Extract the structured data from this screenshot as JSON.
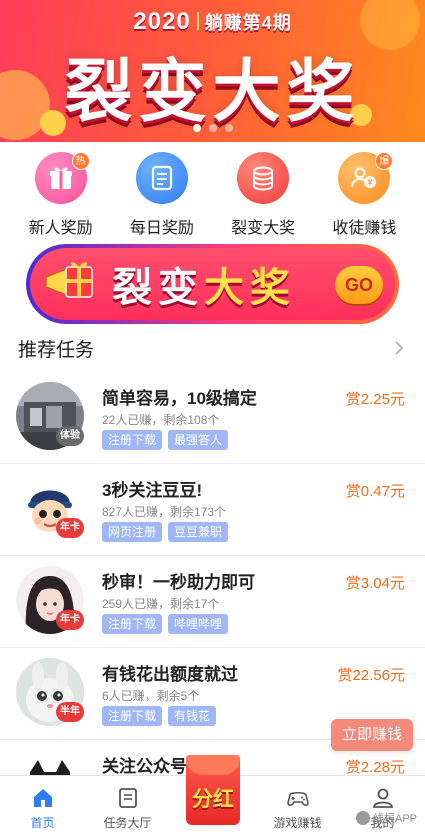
{
  "banner": {
    "year": "2020",
    "subtitle": "躺赚第4期",
    "title": "裂变大奖",
    "slides": 3,
    "active_slide": 1
  },
  "categories": [
    {
      "label": "新人奖励",
      "icon": "gift-icon",
      "badge": "热",
      "color": "#ff5fa2"
    },
    {
      "label": "每日奖励",
      "icon": "checklist-icon",
      "badge": "",
      "color": "#3a8ef6"
    },
    {
      "label": "裂变大奖",
      "icon": "coin-stack-icon",
      "badge": "",
      "color": "#ff4a4a"
    },
    {
      "label": "收徒赚钱",
      "icon": "users-icon",
      "badge": "爆",
      "color": "#ff9a2e"
    }
  ],
  "promo": {
    "text_part1": "裂变",
    "text_part2": "大奖",
    "go_label": "GO"
  },
  "section": {
    "title": "推荐任务"
  },
  "tasks": [
    {
      "title": "简单容易，10级搞定",
      "meta": "22人已赚，剩余108个",
      "tags": [
        "注册下载",
        "最强答人"
      ],
      "reward": "赏2.25元",
      "avatar_tag": "体验",
      "avatar_style": "photo-gray"
    },
    {
      "title": "3秒关注豆豆!",
      "meta": "827人已赚，剩余173个",
      "tags": [
        "网页注册",
        "豆豆兼职"
      ],
      "reward": "赏0.47元",
      "avatar_tag": "年卡",
      "avatar_style": "cartoon"
    },
    {
      "title": "秒审！一秒助力即可",
      "meta": "259人已赚，剩余17个",
      "tags": [
        "注册下载",
        "哔哩哔哩"
      ],
      "reward": "赏3.04元",
      "avatar_tag": "年卡",
      "avatar_style": "girl"
    },
    {
      "title": "有钱花出额度就过",
      "meta": "6人已赚，剩余5个",
      "tags": [
        "注册下载",
        "有钱花"
      ],
      "reward": "赏22.56元",
      "avatar_tag": "半年",
      "avatar_style": "rabbit"
    },
    {
      "title": "关注公众号",
      "meta": "",
      "tags": [],
      "reward": "赏2.28元",
      "avatar_tag": "",
      "avatar_style": "cat"
    }
  ],
  "float_button": "立即赚钱",
  "nav": {
    "items": [
      {
        "label": "首页",
        "icon": "home-icon",
        "active": true
      },
      {
        "label": "任务大厅",
        "icon": "task-hall-icon",
        "active": false
      },
      {
        "label": "",
        "icon": "red-envelope-icon",
        "active": false
      },
      {
        "label": "游戏赚钱",
        "icon": "gamepad-icon",
        "active": false
      },
      {
        "label": "我的",
        "icon": "user-icon",
        "active": false
      }
    ],
    "center_label": "分红"
  },
  "watermark": "线报APP",
  "colors": {
    "accent": "#2f7df0",
    "reward": "#f06b1a",
    "tag_bg": "#9fb8f5",
    "float_btn": "#f48a7a"
  }
}
